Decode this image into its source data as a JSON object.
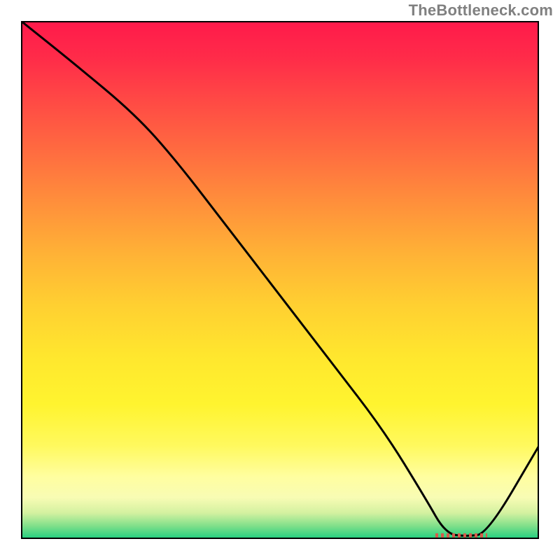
{
  "watermark": "TheBottleneck.com",
  "chart_data": {
    "type": "line",
    "title": "",
    "xlabel": "",
    "ylabel": "",
    "xlim": [
      0,
      100
    ],
    "ylim": [
      0,
      100
    ],
    "grid": false,
    "legend": false,
    "background_gradient": {
      "stops": [
        {
          "offset": 0.0,
          "color": "#ff1a4b"
        },
        {
          "offset": 0.07,
          "color": "#ff2b49"
        },
        {
          "offset": 0.15,
          "color": "#ff4845"
        },
        {
          "offset": 0.25,
          "color": "#ff6b40"
        },
        {
          "offset": 0.35,
          "color": "#ff8f3b"
        },
        {
          "offset": 0.45,
          "color": "#ffb236"
        },
        {
          "offset": 0.55,
          "color": "#ffd031"
        },
        {
          "offset": 0.65,
          "color": "#ffe72e"
        },
        {
          "offset": 0.74,
          "color": "#fff42f"
        },
        {
          "offset": 0.82,
          "color": "#fff95e"
        },
        {
          "offset": 0.88,
          "color": "#fffea0"
        },
        {
          "offset": 0.92,
          "color": "#f8fcb4"
        },
        {
          "offset": 0.95,
          "color": "#d3f1a0"
        },
        {
          "offset": 0.975,
          "color": "#7fdf8a"
        },
        {
          "offset": 1.0,
          "color": "#1fce7f"
        }
      ]
    },
    "series": [
      {
        "name": "bottleneck-curve",
        "color": "#000000",
        "x": [
          0,
          10,
          22,
          30,
          40,
          50,
          60,
          70,
          78,
          82,
          86,
          90,
          100
        ],
        "y": [
          100,
          92,
          82,
          73,
          60,
          47,
          34,
          21,
          8,
          1,
          0.5,
          1,
          18
        ]
      }
    ],
    "highlight_segment": {
      "name": "optimal-range",
      "color": "#d65a4a",
      "x_start": 80,
      "x_end": 90,
      "y": 0.7
    },
    "axes": {
      "frame_color": "#000000",
      "frame_width": 4
    }
  }
}
